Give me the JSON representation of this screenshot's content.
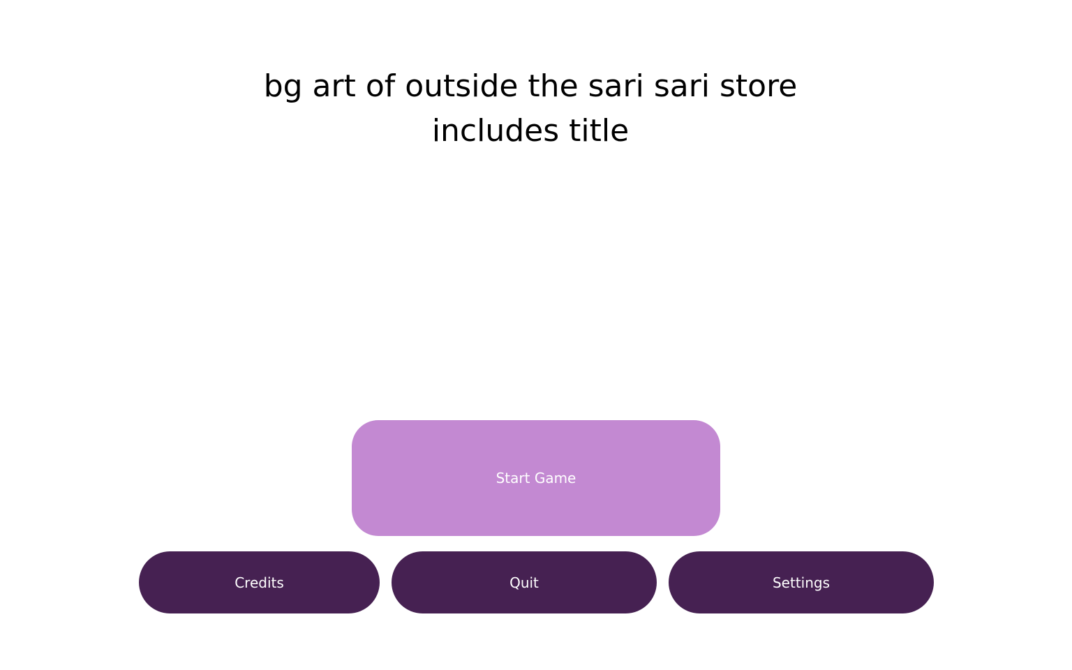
{
  "placeholder": {
    "line1": "bg art of outside the sari sari store",
    "line2": "includes title"
  },
  "menu": {
    "start_label": "Start Game",
    "credits_label": "Credits",
    "quit_label": "Quit",
    "settings_label": "Settings"
  },
  "colors": {
    "background": "#ffffff",
    "start_button": "#c389d2",
    "secondary_button": "#462152",
    "button_text": "#ffffff",
    "placeholder_text": "#000000"
  }
}
